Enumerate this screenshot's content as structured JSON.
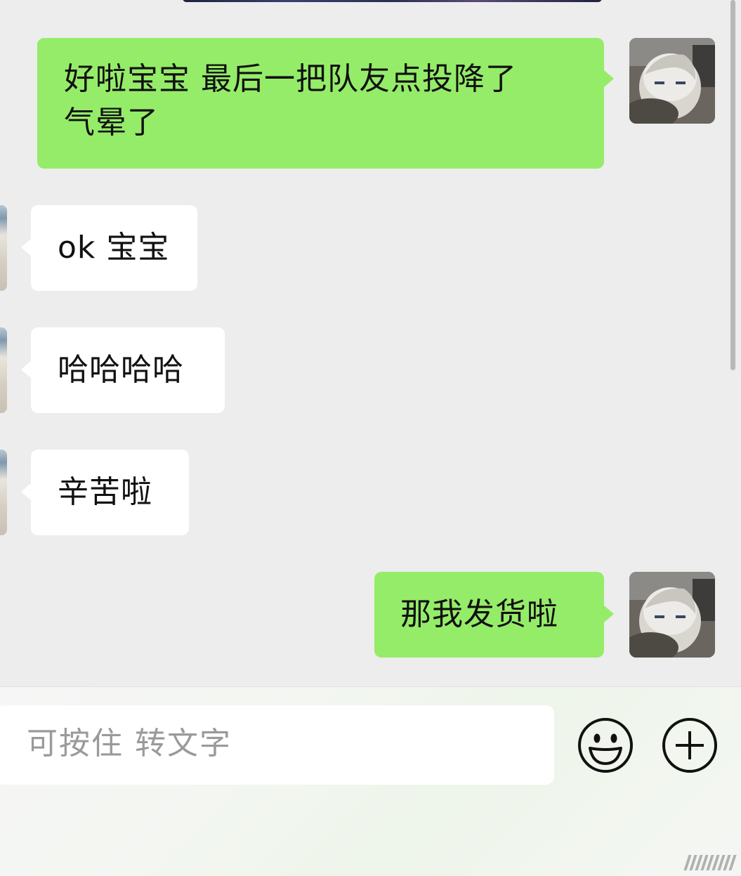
{
  "conversation": {
    "messages": [
      {
        "sender": "me",
        "text": "好啦宝宝 最后一把队友点投降了\n气晕了"
      },
      {
        "sender": "other",
        "text": "ok 宝宝"
      },
      {
        "sender": "other",
        "text": "哈哈哈哈"
      },
      {
        "sender": "other",
        "text": "辛苦啦"
      },
      {
        "sender": "me",
        "text": "那我发货啦"
      }
    ]
  },
  "input_bar": {
    "placeholder": "可按住 转文字",
    "emoji_icon": "smiley-face-icon",
    "more_icon": "plus-circle-icon"
  },
  "colors": {
    "background": "#ededed",
    "my_bubble": "#95ec69",
    "other_bubble": "#ffffff",
    "placeholder_text": "#9a9a9a"
  }
}
